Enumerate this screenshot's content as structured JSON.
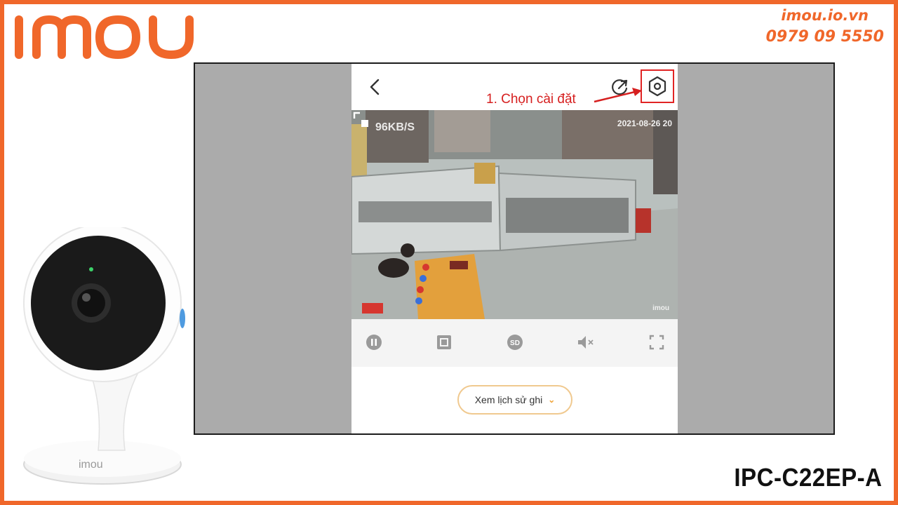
{
  "brand": {
    "logo_text": "IMOU",
    "accent_color": "#f0672a"
  },
  "contact": {
    "website": "imou.io.vn",
    "phone": "0979 09 5550"
  },
  "model": "IPC-C22EP-A",
  "app": {
    "header": {
      "back_icon": "chevron-left-icon",
      "share_icon": "share-icon",
      "settings_icon": "hexagon-gear-icon"
    },
    "annotation": "1. Chọn cài đặt",
    "video": {
      "bitrate": "96KB/S",
      "timestamp": "2021-08-26 20",
      "watermark": "imou"
    },
    "controls": [
      {
        "name": "pause",
        "icon": "pause-icon"
      },
      {
        "name": "multi-screen",
        "icon": "grid-icon"
      },
      {
        "name": "sd-quality",
        "icon": "sd-icon",
        "label": "SD"
      },
      {
        "name": "mute",
        "icon": "speaker-mute-icon"
      },
      {
        "name": "fullscreen",
        "icon": "fullscreen-icon"
      }
    ],
    "history_button": "Xem lịch sử ghi",
    "highlight_color": "#e12424"
  }
}
